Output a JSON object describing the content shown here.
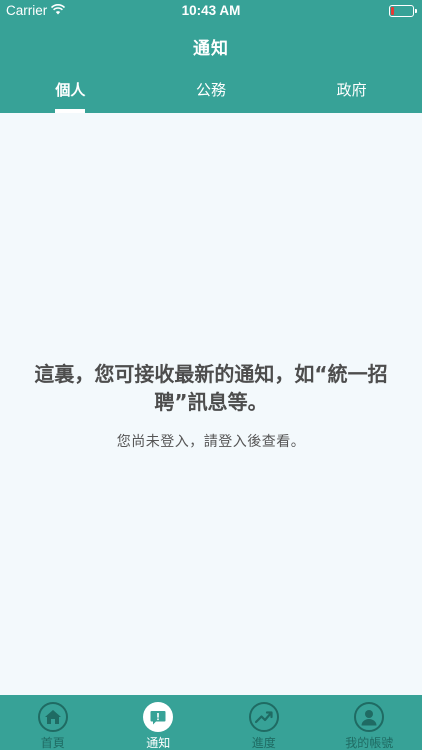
{
  "status_bar": {
    "carrier": "Carrier",
    "time": "10:43 AM",
    "battery_level": 0.12,
    "battery_color": "#e53935"
  },
  "header": {
    "title": "通知",
    "background": "#37a297"
  },
  "tabs": [
    {
      "label": "個人",
      "active": true
    },
    {
      "label": "公務",
      "active": false
    },
    {
      "label": "政府",
      "active": false
    }
  ],
  "empty_state": {
    "message": "這裏，您可接收最新的通知，如“統一招聘”訊息等。",
    "sub_message": "您尚未登入，請登入後查看。"
  },
  "bottom_nav": {
    "items": [
      {
        "label": "首頁",
        "icon": "home-icon",
        "active": false
      },
      {
        "label": "通知",
        "icon": "notification-icon",
        "active": true
      },
      {
        "label": "進度",
        "icon": "progress-icon",
        "active": false
      },
      {
        "label": "我的帳號",
        "icon": "account-icon",
        "active": false
      }
    ]
  }
}
